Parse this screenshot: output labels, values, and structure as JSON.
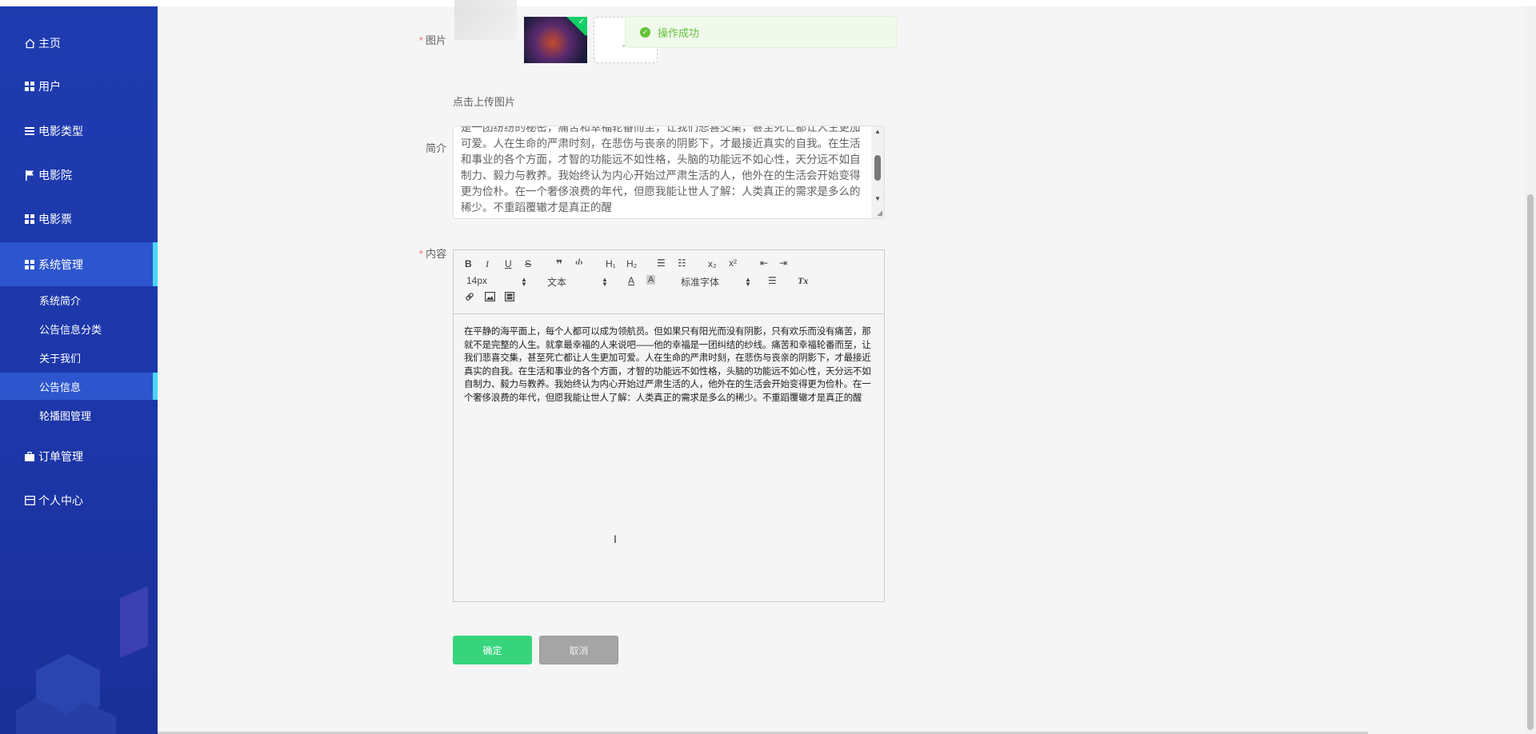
{
  "sidebar": {
    "items": [
      {
        "label": "主页",
        "icon": "home-icon"
      },
      {
        "label": "用户",
        "icon": "grid-icon"
      },
      {
        "label": "电影类型",
        "icon": "list-icon"
      },
      {
        "label": "电影院",
        "icon": "flag-icon"
      },
      {
        "label": "电影票",
        "icon": "grid-icon"
      },
      {
        "label": "系统管理",
        "icon": "grid-icon"
      },
      {
        "label": "订单管理",
        "icon": "briefcase-icon"
      },
      {
        "label": "个人中心",
        "icon": "card-icon"
      }
    ],
    "sub_items": [
      "系统简介",
      "公告信息分类",
      "关于我们",
      "公告信息",
      "轮播图管理"
    ],
    "active_item": "系统管理",
    "active_sub": "公告信息"
  },
  "form": {
    "image_label": "图片",
    "upload_tip": "点击上传图片",
    "upload_box_text": "_",
    "intro_label": "简介",
    "intro_text": "是一团纷纷的秘密，痛苦和幸福轮番而至，让我们悲喜交集，甚至死亡都让人生更加可爱。人在生命的严肃时刻，在悲伤与丧亲的阴影下，才最接近真实的自我。在生活和事业的各个方面，才智的功能远不如性格，头脑的功能远不如心性，天分远不如自制力、毅力与教养。我始终认为内心开始过严肃生活的人，他外在的生活会开始变得更为俭朴。在一个奢侈浪费的年代，但愿我能让世人了解：人类真正的需求是多么的稀少。不重蹈覆辙才是真正的醒",
    "content_label": "内容",
    "content_text": "在平静的海平面上，每个人都可以成为领航员。但如果只有阳光而没有阴影，只有欢乐而没有痛苦，那就不是完整的人生。就拿最幸福的人来说吧——他的幸福是一团纠结的纱线。痛苦和幸福轮番而至，让我们悲喜交集，甚至死亡都让人生更加可爱。人在生命的严肃时刻，在悲伤与丧亲的阴影下，才最接近真实的自我。在生活和事业的各个方面，才智的功能远不如性格，头脑的功能远不如心性，天分远不如自制力、毅力与教养。我始终认为内心开始过严肃生活的人，他外在的生活会开始变得更为俭朴。在一个奢侈浪费的年代，但愿我能让世人了解：人类真正的需求是多么的稀少。不重蹈覆辙才是真正的醒",
    "required_mark": "*"
  },
  "toast": {
    "message": "操作成功"
  },
  "editor": {
    "toolbar_row1": [
      "B",
      "I",
      "U",
      "S",
      "❞",
      "‹/›",
      "H₁",
      "H₂",
      "☰",
      "☷",
      "x₂",
      "x²",
      "⇤",
      "⇥"
    ],
    "size_picker": "14px",
    "header_picker": "文本",
    "font_picker": "标准字体",
    "color_btn": "A",
    "bg_btn": "A",
    "align_btn": "☰",
    "clean_btn": "Tx"
  },
  "buttons": {
    "confirm": "确定",
    "cancel": "取消"
  },
  "colors": {
    "sidebar_bg": "#1e3cb0",
    "active_bg": "#2d55cd",
    "active_bar": "#49d6f5",
    "confirm_btn": "#36d57c",
    "success_green": "#67c23a"
  }
}
